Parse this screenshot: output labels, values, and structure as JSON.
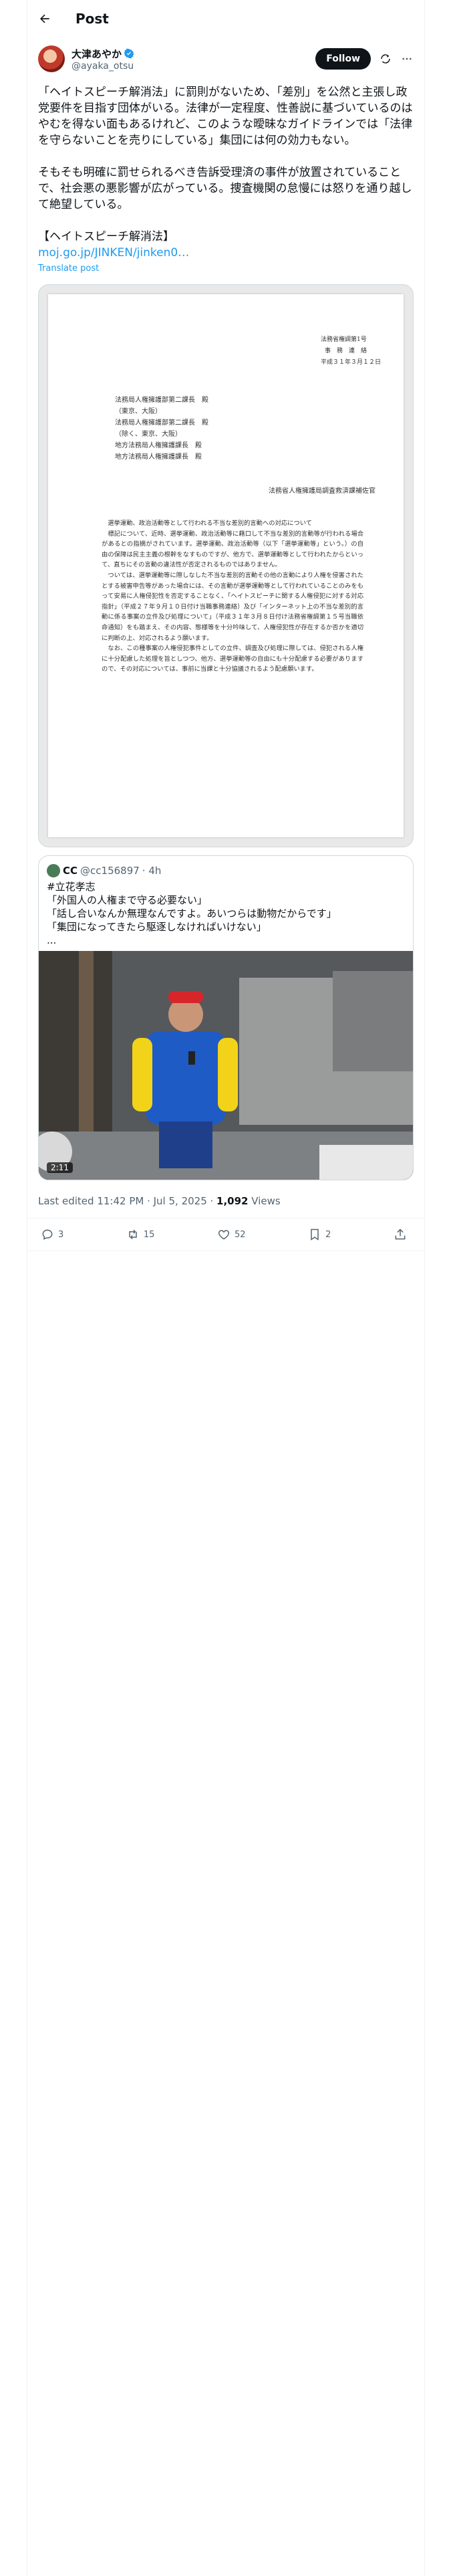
{
  "topbar": {
    "title": "Post"
  },
  "author": {
    "name": "大津あやか",
    "handle": "@ayaka_otsu",
    "follow_label": "Follow"
  },
  "post": {
    "paragraph1": "「ヘイトスピーチ解消法」に罰則がないため、「差別」を公然と主張し政党要件を目指す団体がいる。法律が一定程度、性善説に基づいているのはやむを得ない面もあるけれど、このような曖昧なガイドラインでは「法律を守らないことを売りにしている」集団には何の効力もない。",
    "paragraph2": "そもそも明確に罰せられるべき告訴受理済の事件が放置されていることで、社会悪の悪影響が広がっている。捜査機関の怠慢には怒りを通り越して絶望している。",
    "paragraph3": "【ヘイトスピーチ解消法】",
    "link": "moj.go.jp/JINKEN/jinken0…",
    "translate": "Translate post"
  },
  "document": {
    "number": "法務省権調第1号",
    "header_line1": "事　務　連　絡",
    "date": "平成３１年３月１２日",
    "recipients": "法務局人権擁護部第二課長　殿\n（東京、大阪）\n法務局人権擁護部第二課長　殿\n（除く、東京、大阪）\n地方法務局人権擁護課長　殿\n地方法務局人権擁護課長　殿",
    "sender": "法務省人権擁護局調査救済課補佐官",
    "body": "　選挙運動、政治活動等として行われる不当な差別的言動への対応について\n　標記について、近時、選挙運動、政治活動等に藉口して不当な差別的言動等が行われる場合があるとの指摘がされています。選挙運動、政治活動等（以下「選挙運動等」という。）の自由の保障は民主主義の根幹をなすものですが、他方で、選挙運動等として行われたからといって、直ちにその言動の違法性が否定されるものではありません。\n　ついては、選挙運動等に際しなした不当な差別的言動その他の言動により人権を侵害されたとする被害申告等があった場合には、その言動が選挙運動等として行われていることのみをもって安易に人権侵犯性を否定することなく、「ヘイトスピーチに関する人権侵犯に対する対応指針」（平成２７年９月１０日付け当職事務連絡）及び「インターネット上の不当な差別的言動に係る事案の立件及び処理について」（平成３１年３月８日付け法務省権調第１５号当職依命通知）をも踏まえ、その内容、態様等を十分吟味して、人権侵犯性が存在するか否かを適切に判断の上、対応されるよう願います。\n　なお、この種事案の人権侵犯事件としての立件、調査及び処理に際しては、侵犯される人権に十分配慮した処理を旨としつつ、他方、選挙運動等の自由にも十分配慮する必要がありますので、その対応については、事前に当課と十分協議されるよう配慮願います。"
  },
  "quote": {
    "name": "CC",
    "handle": "@cc156897",
    "time": "· 4h",
    "text": "#立花孝志\n「外国人の人権まで守る必要ない」\n「話し合いなんか無理なんですよ。あいつらは動物だからです」\n「集団になってきたら駆逐しなければいけない」\n...",
    "video_duration": "2:11"
  },
  "meta": {
    "edited": "Last edited 11:42 PM · Jul 5, 2025 · ",
    "views_count": "1,092",
    "views_label": " Views"
  },
  "actions": {
    "replies": "3",
    "reposts": "15",
    "likes": "52",
    "bookmarks": "2"
  },
  "colors": {
    "accent": "#1d9bf0",
    "text": "#0f1419",
    "muted": "#536471"
  }
}
